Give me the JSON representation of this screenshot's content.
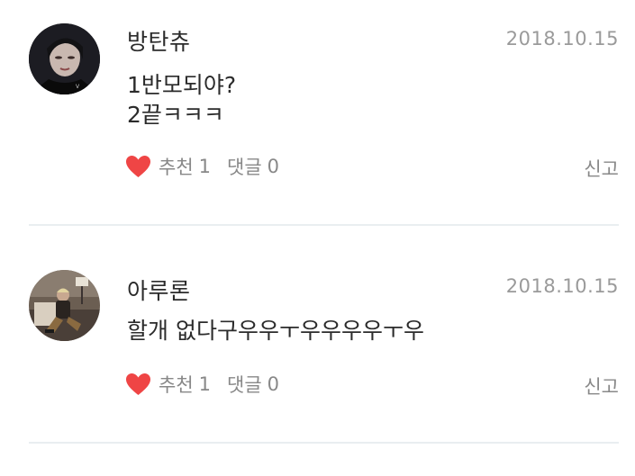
{
  "comments": [
    {
      "author": "방탄츄",
      "date": "2018.10.15",
      "text": "1반모되야?\n2끝ㅋㅋㅋ",
      "like_label": "추천",
      "like_count": "1",
      "reply_label": "댓글",
      "reply_count": "0",
      "report_label": "신고",
      "avatar_icon": "profile-photo-dark-portrait"
    },
    {
      "author": "아루론",
      "date": "2018.10.15",
      "text": "할개 없다구우우ㅜ우우우우ㅜ우",
      "like_label": "추천",
      "like_count": "1",
      "reply_label": "댓글",
      "reply_count": "0",
      "report_label": "신고",
      "avatar_icon": "profile-photo-seated-person"
    }
  ],
  "colors": {
    "heart": "#ef4545",
    "meta_text": "#888888",
    "date_text": "#9a9a9a",
    "divider": "#e9eef0"
  }
}
